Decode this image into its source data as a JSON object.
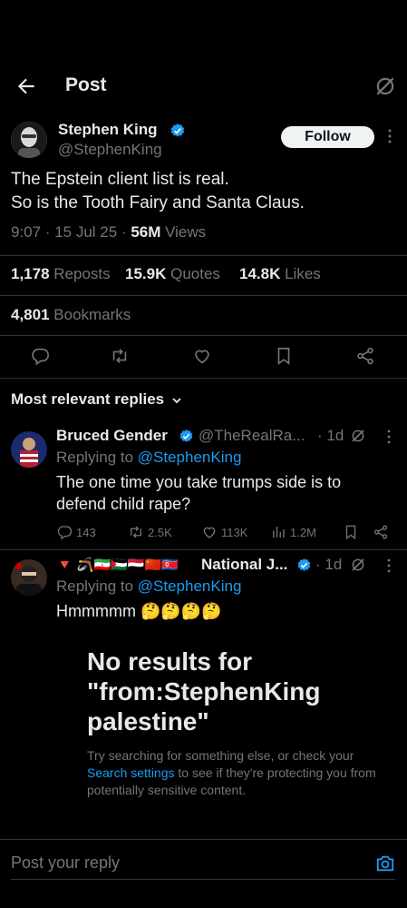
{
  "header": {
    "title": "Post",
    "back_icon": "arrow-left-icon",
    "grok_icon": "grok-icon"
  },
  "tweet": {
    "author_name": "Stephen King",
    "author_handle": "@StephenKing",
    "follow_label": "Follow",
    "text_line1": "The Epstein client list is real.",
    "text_line2": "So is the Tooth Fairy and Santa Claus.",
    "time": "9:07 · 15 Jul 25 · ",
    "views_count": "56M",
    "views_label": " Views",
    "reposts_count": "1,178",
    "reposts_label": " Reposts",
    "quotes_count": "15.9K",
    "quotes_label": " Quotes",
    "likes_count": "14.8K",
    "likes_label": " Likes",
    "bookmarks_count": "4,801",
    "bookmarks_label": " Bookmarks"
  },
  "replies_header": "Most relevant replies",
  "replies": [
    {
      "name": "Bruced Gender",
      "handle": "@TheRealRa...",
      "age": "· 1d",
      "replying_prefix": "Replying to ",
      "replying_handle": "@StephenKing",
      "text_line1": "The one time you take trumps side is to",
      "text_line2": "defend child rape?",
      "replies": "143",
      "reposts": "2.5K",
      "likes": "113K",
      "views": "1.2M"
    },
    {
      "name": "National J...",
      "flags": "🔻 🪃🇮🇷🇵🇸🇾🇪🇨🇳🇰🇵",
      "age": "· 1d",
      "replying_prefix": "Replying to ",
      "replying_handle": "@StephenKing",
      "text": "Hmmmmm",
      "emojis": "🤔🤔🤔🤔"
    }
  ],
  "no_results": {
    "title": "No results for \"from:StephenKing palestine\"",
    "body_pre": "Try searching for something else, or check your ",
    "body_link": "Search settings",
    "body_post": " to see if they're protecting you from potentially sensitive content."
  },
  "compose": {
    "placeholder": "Post your reply",
    "camera_icon": "camera-icon"
  },
  "colors": {
    "background": "#000000",
    "accent": "#1d9bf0",
    "muted": "#71767b",
    "text": "#e7e9ea",
    "divider": "#2f3336"
  }
}
